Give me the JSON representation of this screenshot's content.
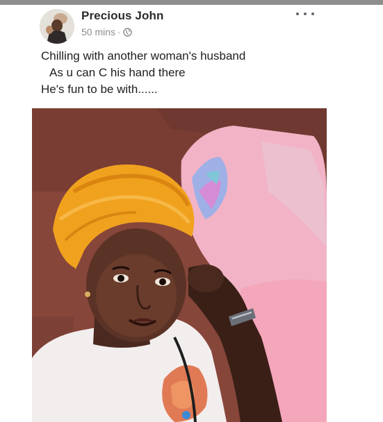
{
  "post": {
    "author": "Precious John",
    "timestamp": "50 mins",
    "separator": "·",
    "privacy_icon": "globe-icon",
    "more_icon": "more-options-icon",
    "caption_lines": [
      "Chilling with another woman's  husband",
      "As u can C his hand there",
      "He's fun to be with......"
    ]
  },
  "colors": {
    "name_text": "#2b2b2b",
    "meta_text": "#8a8d91",
    "top_bar": "#8e8e8e"
  }
}
